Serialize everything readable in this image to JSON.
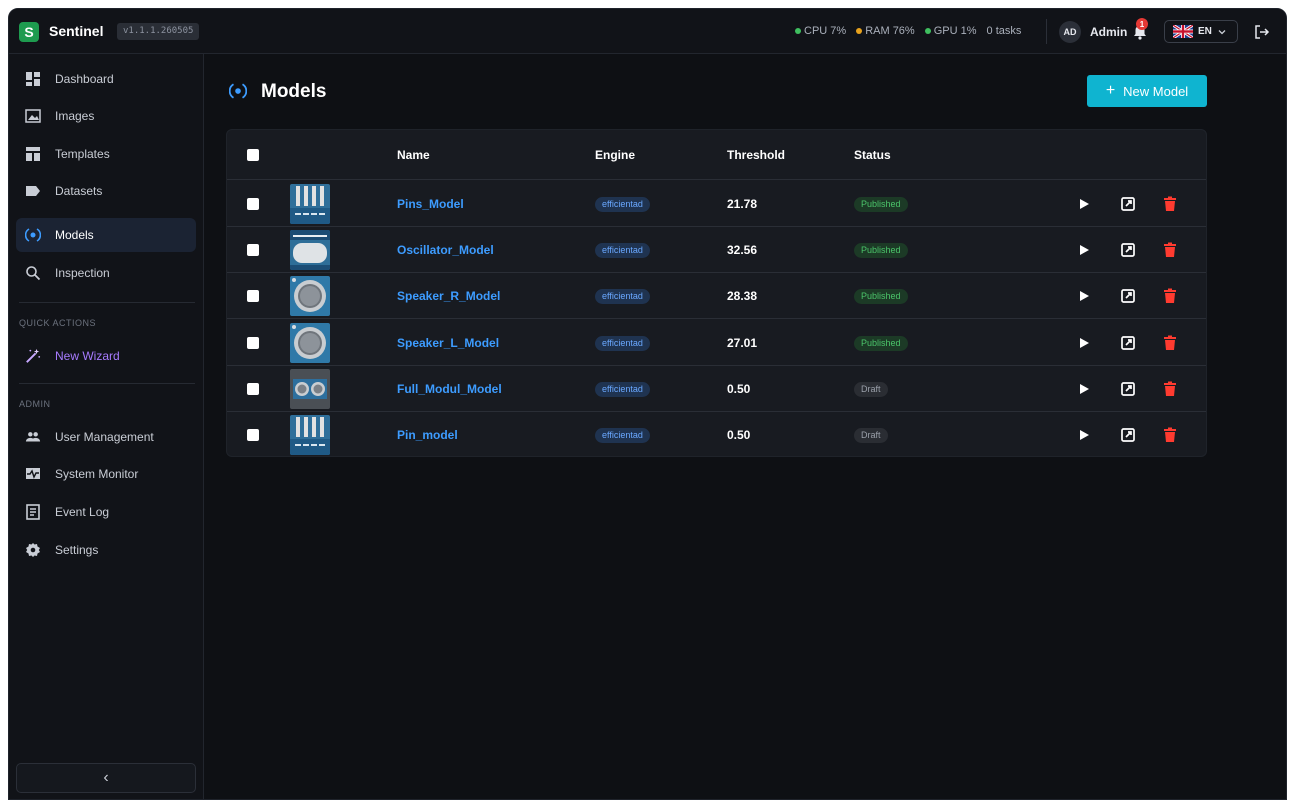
{
  "app": {
    "logo_letter": "S",
    "name": "Sentinel",
    "version": "v1.1.1.260505"
  },
  "status": {
    "cpu": "CPU 7%",
    "ram": "RAM 76%",
    "gpu": "GPU 1%",
    "tasks": "0 tasks",
    "colors": {
      "ok": "#3fbf5f",
      "warn": "#e8a21d"
    }
  },
  "user": {
    "initials": "AD",
    "name": "Admin",
    "notifications": "1",
    "language": "EN"
  },
  "sidebar": {
    "items": [
      {
        "label": "Dashboard",
        "icon": "dashboard-icon"
      },
      {
        "label": "Images",
        "icon": "image-icon"
      },
      {
        "label": "Templates",
        "icon": "templates-icon"
      },
      {
        "label": "Datasets",
        "icon": "tag-icon"
      },
      {
        "label": "Models",
        "icon": "model-icon",
        "active": true
      },
      {
        "label": "Inspection",
        "icon": "search-icon"
      }
    ],
    "quick_actions_title": "QUICK ACTIONS",
    "quick_actions": [
      {
        "label": "New Wizard",
        "icon": "magic-wand-icon",
        "color": "#a77bff"
      }
    ],
    "admin_title": "ADMIN",
    "admin_items": [
      {
        "label": "User Management",
        "icon": "users-icon"
      },
      {
        "label": "System Monitor",
        "icon": "monitor-icon"
      },
      {
        "label": "Event Log",
        "icon": "log-icon"
      },
      {
        "label": "Settings",
        "icon": "gear-icon"
      }
    ],
    "collapse_glyph": "‹"
  },
  "page": {
    "title": "Models",
    "new_button": "New Model",
    "accent": "#0fb4d0"
  },
  "table": {
    "columns": {
      "name": "Name",
      "engine": "Engine",
      "threshold": "Threshold",
      "status": "Status"
    },
    "rows": [
      {
        "name": "Pins_Model",
        "engine": "efficientad",
        "threshold": "21.78",
        "status": "Published",
        "thumb": "pins"
      },
      {
        "name": "Oscillator_Model",
        "engine": "efficientad",
        "threshold": "32.56",
        "status": "Published",
        "thumb": "oscillator"
      },
      {
        "name": "Speaker_R_Model",
        "engine": "efficientad",
        "threshold": "28.38",
        "status": "Published",
        "thumb": "speaker"
      },
      {
        "name": "Speaker_L_Model",
        "engine": "efficientad",
        "threshold": "27.01",
        "status": "Published",
        "thumb": "speaker"
      },
      {
        "name": "Full_Modul_Model",
        "engine": "efficientad",
        "threshold": "0.50",
        "status": "Draft",
        "thumb": "module"
      },
      {
        "name": "Pin_model",
        "engine": "efficientad",
        "threshold": "0.50",
        "status": "Draft",
        "thumb": "pins"
      }
    ]
  }
}
